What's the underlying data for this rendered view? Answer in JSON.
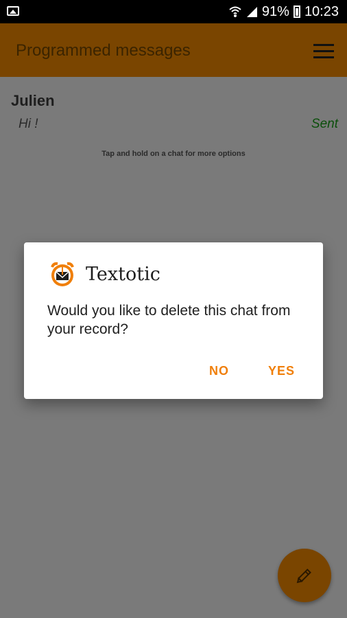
{
  "status_bar": {
    "battery": "91%",
    "time": "10:23"
  },
  "app_bar": {
    "title": "Programmed messages"
  },
  "chat": {
    "contact": "Julien",
    "message": "Hi !",
    "status": "Sent"
  },
  "hint": "Tap and hold on a chat for more options",
  "dialog": {
    "title": "Textotic",
    "body": "Would you like to delete this chat from your record?",
    "no_label": "NO",
    "yes_label": "YES"
  },
  "colors": {
    "accent": "#f07f0a",
    "appbar_dimmed": "#7a4500",
    "sent_dimmed": "#0b4f0b"
  },
  "icons": {
    "status_left": "image-icon",
    "wifi": "wifi-icon",
    "signal": "signal-icon",
    "battery": "battery-icon",
    "menu": "hamburger-menu-icon",
    "dialog_app": "alarm-envelope-icon",
    "fab": "pencil-icon"
  }
}
